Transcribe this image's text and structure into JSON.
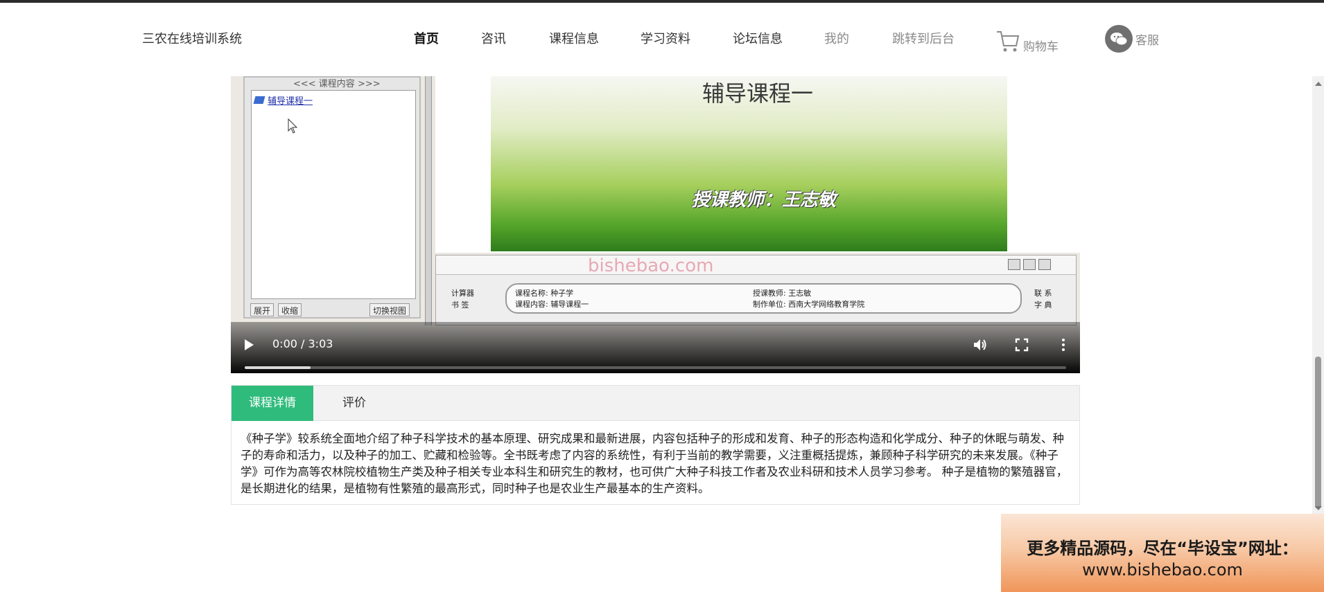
{
  "header": {
    "brand": "三农在线培训系统",
    "nav": [
      "首页",
      "咨讯",
      "课程信息",
      "学习资料",
      "论坛信息",
      "我的",
      "跳转到后台"
    ],
    "cart_label": "购物车",
    "service_label": "客服"
  },
  "video": {
    "panel_title": "<<< 课程内容 >>>",
    "course_item": "辅导课程一",
    "panel_buttons": [
      "展开",
      "收缩",
      "切换视图"
    ],
    "slide_title": "辅导课程一",
    "slide_teacher": "授课教师：王志敏",
    "info_course_name": "课程名称: 种子学",
    "info_course_content": "课程内容: 辅导课程一",
    "info_teacher": "授课教师: 王志敏",
    "info_producer": "制作单位: 西南大学网络教育学院",
    "left_links": [
      "计算器",
      "书 签"
    ],
    "right_links": [
      "联 系",
      "字 典"
    ],
    "watermark": "bishebao.com",
    "time": "0:00 / 3:03",
    "progress": 0.08
  },
  "tabs": {
    "details": "课程详情",
    "reviews": "评价",
    "description": "《种子学》较系统全面地介绍了种子科学技术的基本原理、研究成果和最新进展，内容包括种子的形成和发育、种子的形态构造和化学成分、种子的休眠与萌发、种子的寿命和活力，以及种子的加工、贮藏和检验等。全书既考虑了内容的系统性，有利于当前的教学需要，义注重概括提炼，兼顾种子科学研究的未来发展。《种子学》可作为高等农林院校植物生产类及种子相关专业本科生和研究生的教材，也可供广大种子科技工作者及农业科研和技术人员学习参考。 种子是植物的繁殖器官，是长期进化的结果，是植物有性繁殖的最高形式，同时种子也是农业生产最基本的生产资料。"
  },
  "promo": {
    "line1": "更多精品源码，尽在“毕设宝”网址：",
    "line2": "www.bishebao.com"
  },
  "colors": {
    "accent": "#2fbb7c"
  }
}
